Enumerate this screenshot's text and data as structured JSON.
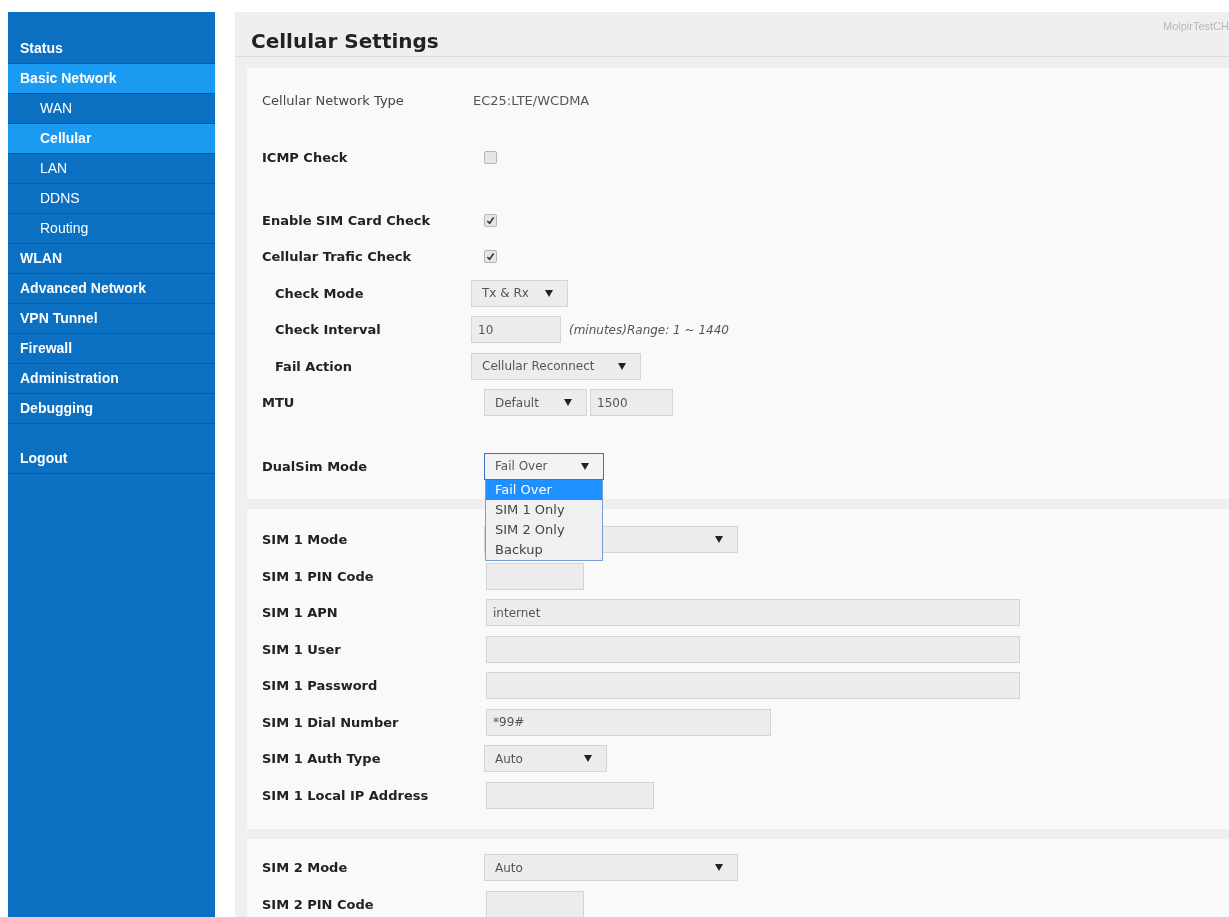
{
  "sidebar": {
    "items": [
      {
        "label": "Status",
        "selected": false
      },
      {
        "label": "Basic Network",
        "selected": true,
        "children": [
          {
            "label": "WAN",
            "selected": false
          },
          {
            "label": "Cellular",
            "selected": true
          },
          {
            "label": "LAN",
            "selected": false
          },
          {
            "label": "DDNS",
            "selected": false
          },
          {
            "label": "Routing",
            "selected": false
          }
        ]
      },
      {
        "label": "WLAN",
        "selected": false
      },
      {
        "label": "Advanced Network",
        "selected": false
      },
      {
        "label": "VPN Tunnel",
        "selected": false
      },
      {
        "label": "Firewall",
        "selected": false
      },
      {
        "label": "Administration",
        "selected": false
      },
      {
        "label": "Debugging",
        "selected": false
      },
      {
        "label": "Logout",
        "selected": false,
        "kind": "logout"
      }
    ]
  },
  "header": {
    "title": "Cellular Settings",
    "user": "MolpirTestCH"
  },
  "sections": [
    {
      "rows": [
        {
          "kind": "text",
          "label": "Cellular Network Type",
          "value": "EC25:LTE/WCDMA"
        },
        {
          "kind": "checkbox",
          "label": "ICMP Check",
          "checked": false
        },
        {
          "kind": "checkbox",
          "label": "Enable SIM Card Check",
          "checked": true
        },
        {
          "kind": "checkbox",
          "label": "Cellular Trafic Check",
          "checked": true,
          "children": [
            {
              "kind": "select",
              "label": "Check Mode",
              "value": "Tx & Rx"
            },
            {
              "kind": "input",
              "label": "Check Interval",
              "value": "10",
              "note": "(minutes)Range: 1 ~ 1440"
            },
            {
              "kind": "select",
              "label": "Fail Action",
              "value": "Cellular Reconnect"
            }
          ]
        },
        {
          "kind": "select_input",
          "label": "MTU",
          "value": "Default",
          "input_value": "1500"
        },
        {
          "kind": "select",
          "label": "DualSim Mode",
          "value": "Fail Over",
          "expanded": true,
          "options": [
            {
              "label": "Fail Over",
              "selected": true
            },
            {
              "label": "SIM 1 Only",
              "selected": false
            },
            {
              "label": "SIM 2 Only",
              "selected": false
            },
            {
              "label": "Backup",
              "selected": false
            }
          ]
        }
      ]
    },
    {
      "rows": [
        {
          "kind": "select",
          "label": "SIM 1 Mode"
        },
        {
          "kind": "input",
          "label": "SIM 1 PIN Code"
        },
        {
          "kind": "input",
          "label": "SIM 1 APN",
          "value": "internet"
        },
        {
          "kind": "input",
          "label": "SIM 1 User"
        },
        {
          "kind": "input",
          "label": "SIM 1 Password"
        },
        {
          "kind": "input",
          "label": "SIM 1 Dial Number",
          "value": "*99#"
        },
        {
          "kind": "select",
          "label": "SIM 1 Auth Type",
          "value": "Auto"
        },
        {
          "kind": "input",
          "label": "SIM 1 Local IP Address"
        }
      ]
    },
    {
      "rows": [
        {
          "kind": "select",
          "label": "SIM 2 Mode",
          "value": "Auto"
        },
        {
          "kind": "input",
          "label": "SIM 2 PIN Code"
        }
      ]
    }
  ]
}
